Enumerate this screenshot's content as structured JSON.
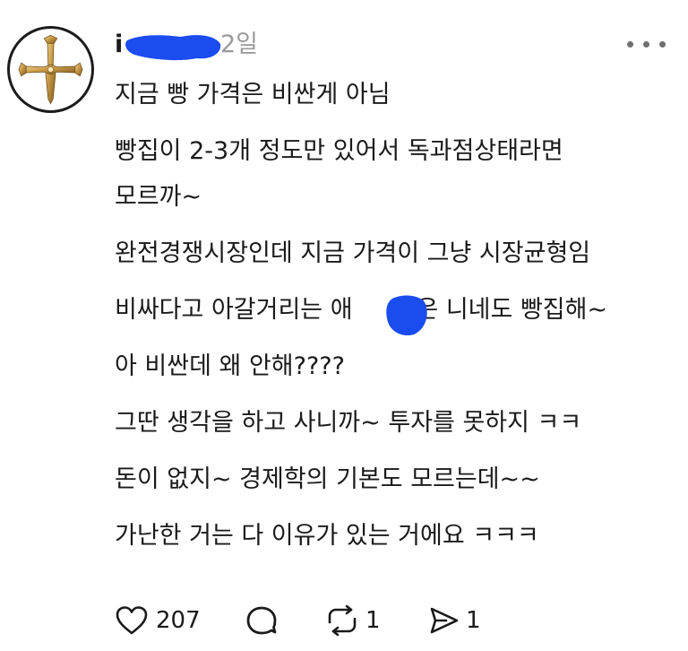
{
  "post": {
    "username": "i",
    "time": "2일",
    "paragraphs": [
      [
        "지금 빵 가격은 비싼게 아님"
      ],
      [
        "빵집이 2-3개 정도만 있어서 독과점상태라면",
        "모르까~"
      ],
      [
        "완전경쟁시장인데 지금 가격이 그냥 시장균형임"
      ],
      [
        "비싸다고 아갈거리는 애",
        "들은 니네도 빵집해~"
      ],
      [
        "아 비싼데 왜 안해????"
      ],
      [
        "그딴 생각을 하고 사니까~ 투자를 못하지 ㅋㅋ"
      ],
      [
        "돈이 없지~ 경제학의 기본도 모르는데~~"
      ],
      [
        "가난한 거는 다 이유가 있는 거에요 ㅋㅋㅋ"
      ]
    ]
  },
  "actions": {
    "like_count": "207",
    "repost_count": "1",
    "share_count": "1"
  },
  "icons": {
    "avatar": "golden-cross-icon",
    "more": "more-dots-icon",
    "like": "heart-icon",
    "comment": "comment-bubble-icon",
    "repost": "repost-icon",
    "share": "send-icon"
  },
  "colors": {
    "redaction": "#1a4cf0",
    "muted": "#9a9a9a",
    "text": "#1a1a1a"
  }
}
